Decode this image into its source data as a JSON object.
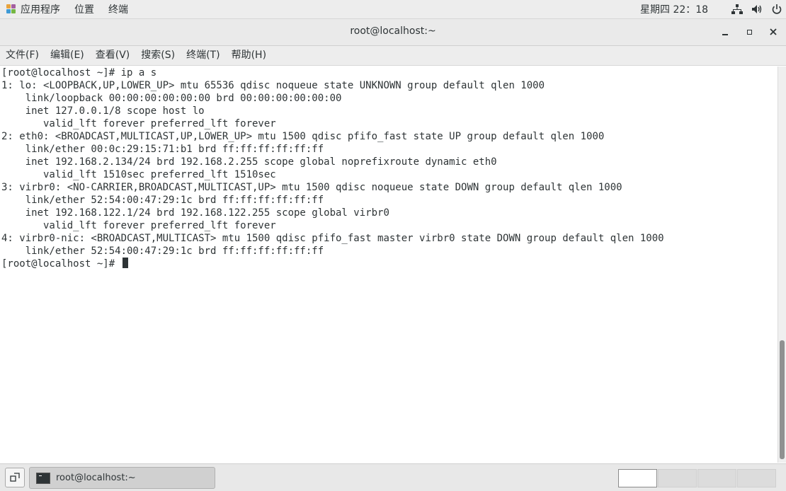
{
  "top_panel": {
    "menus": [
      "应用程序",
      "位置",
      "终端"
    ],
    "clock": "星期四 22：18",
    "tray_icons": [
      "network-icon",
      "volume-icon",
      "power-icon"
    ]
  },
  "window": {
    "title": "root@localhost:~",
    "buttons": [
      "minimize",
      "maximize",
      "close"
    ]
  },
  "menubar": {
    "items": [
      "文件(F)",
      "编辑(E)",
      "查看(V)",
      "搜索(S)",
      "终端(T)",
      "帮助(H)"
    ]
  },
  "terminal": {
    "lines": [
      "[root@localhost ~]# ip a s",
      "1: lo: <LOOPBACK,UP,LOWER_UP> mtu 65536 qdisc noqueue state UNKNOWN group default qlen 1000",
      "    link/loopback 00:00:00:00:00:00 brd 00:00:00:00:00:00",
      "    inet 127.0.0.1/8 scope host lo",
      "       valid_lft forever preferred_lft forever",
      "2: eth0: <BROADCAST,MULTICAST,UP,LOWER_UP> mtu 1500 qdisc pfifo_fast state UP group default qlen 1000",
      "    link/ether 00:0c:29:15:71:b1 brd ff:ff:ff:ff:ff:ff",
      "    inet 192.168.2.134/24 brd 192.168.2.255 scope global noprefixroute dynamic eth0",
      "       valid_lft 1510sec preferred_lft 1510sec",
      "3: virbr0: <NO-CARRIER,BROADCAST,MULTICAST,UP> mtu 1500 qdisc noqueue state DOWN group default qlen 1000",
      "    link/ether 52:54:00:47:29:1c brd ff:ff:ff:ff:ff:ff",
      "    inet 192.168.122.1/24 brd 192.168.122.255 scope global virbr0",
      "       valid_lft forever preferred_lft forever",
      "4: virbr0-nic: <BROADCAST,MULTICAST> mtu 1500 qdisc pfifo_fast master virbr0 state DOWN group default qlen 1000",
      "    link/ether 52:54:00:47:29:1c brd ff:ff:ff:ff:ff:ff"
    ],
    "prompt": "[root@localhost ~]# "
  },
  "taskbar": {
    "task_label": "root@localhost:~",
    "workspaces": 4,
    "active_workspace": 1
  },
  "colors": {
    "panel_bg": "#ededed",
    "terminal_fg": "#2e3436",
    "terminal_bg": "#ffffff"
  }
}
